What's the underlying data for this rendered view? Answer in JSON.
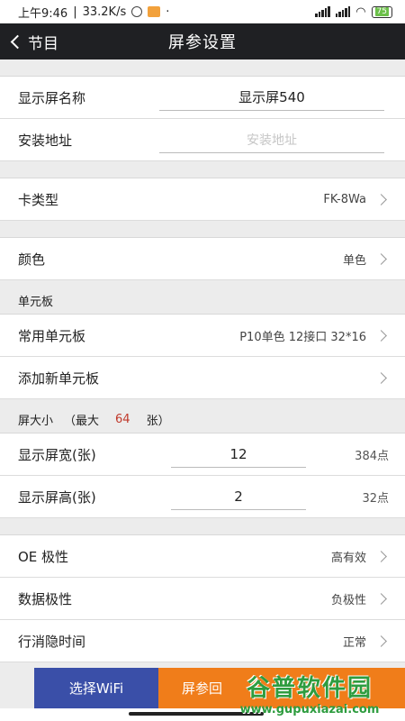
{
  "status_bar": {
    "time": "上午9:46",
    "speed": "33.2K/s",
    "battery": "75"
  },
  "nav": {
    "back_label": "节目",
    "title": "屏参设置"
  },
  "screen_name": {
    "label": "显示屏名称",
    "value": "显示屏540"
  },
  "install_address": {
    "label": "安装地址",
    "placeholder": "安装地址"
  },
  "card_type": {
    "label": "卡类型",
    "value": "FK-8Wa"
  },
  "color": {
    "label": "颜色",
    "value": "单色"
  },
  "unit_board": {
    "section_label": "单元板",
    "common_label": "常用单元板",
    "common_value": "P10单色 12接口 32*16",
    "add_label": "添加新单元板"
  },
  "screen_size": {
    "section_prefix": "屏大小",
    "max_prefix": "（最大",
    "max_value": "64",
    "max_suffix": "张）",
    "width_label": "显示屏宽(张)",
    "width_value": "12",
    "width_points": "384点",
    "height_label": "显示屏高(张)",
    "height_value": "2",
    "height_points": "32点"
  },
  "oe_polarity": {
    "label": "OE 极性",
    "value": "高有效"
  },
  "data_polarity": {
    "label": "数据极性",
    "value": "负极性"
  },
  "line_blank": {
    "label": "行消隐时间",
    "value": "正常"
  },
  "bottom": {
    "wifi_button": "选择WiFi",
    "send_button": "屏参回"
  },
  "watermark": {
    "title": "谷普软件园",
    "url": "www.gupuxiazai.com"
  },
  "colors": {
    "nav_bg": "#1f2023",
    "wifi_button": "#3a4fa8",
    "send_button": "#f07d1a",
    "accent_red": "#c0392b",
    "watermark_green": "#2e9c3f"
  }
}
